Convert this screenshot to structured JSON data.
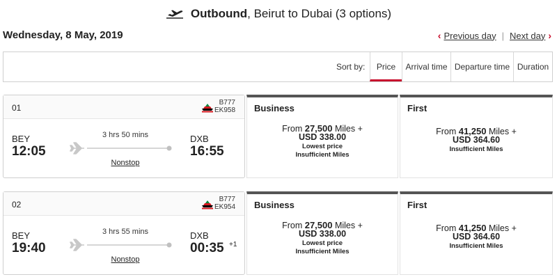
{
  "header": {
    "title_bold": "Outbound",
    "title_rest": ", Beirut to Dubai (3 options)"
  },
  "date": "Wednesday, 8 May, 2019",
  "nav": {
    "prev": "Previous day",
    "next": "Next day"
  },
  "sort": {
    "label": "Sort by:",
    "options": [
      "Price",
      "Arrival time",
      "Departure time",
      "Duration"
    ],
    "active": "Price"
  },
  "flights": [
    {
      "number": "01",
      "aircraft": "B777",
      "code": "EK958",
      "origin": "BEY",
      "dep_time": "12:05",
      "duration": "3 hrs 50 mins",
      "stops": "Nonstop",
      "dest": "DXB",
      "arr_time": "16:55",
      "day_offset": "",
      "fares": [
        {
          "cabin": "Business",
          "prefix": "From ",
          "miles": "27,500",
          "suffix": " Miles +",
          "cash": "USD 338.00",
          "notes": [
            "Lowest price",
            "Insufficient Miles"
          ]
        },
        {
          "cabin": "First",
          "prefix": "From ",
          "miles": "41,250",
          "suffix": " Miles +",
          "cash": "USD 364.60",
          "notes": [
            "Insufficient Miles"
          ]
        }
      ]
    },
    {
      "number": "02",
      "aircraft": "B777",
      "code": "EK954",
      "origin": "BEY",
      "dep_time": "19:40",
      "duration": "3 hrs 55 mins",
      "stops": "Nonstop",
      "dest": "DXB",
      "arr_time": "00:35",
      "day_offset": "+1",
      "fares": [
        {
          "cabin": "Business",
          "prefix": "From ",
          "miles": "27,500",
          "suffix": " Miles +",
          "cash": "USD 338.00",
          "notes": [
            "Lowest price",
            "Insufficient Miles"
          ]
        },
        {
          "cabin": "First",
          "prefix": "From ",
          "miles": "41,250",
          "suffix": " Miles +",
          "cash": "USD 364.60",
          "notes": [
            "Insufficient Miles"
          ]
        }
      ]
    }
  ],
  "colors": {
    "accent": "#c8102e",
    "fare_top_border": "#555555",
    "border": "#cfcfcf"
  },
  "icons": {
    "header": "plane-takeoff-icon",
    "route": "plane-icon",
    "logo": "emirates-logo",
    "prev": "chevron-left-icon",
    "next": "chevron-right-icon"
  }
}
